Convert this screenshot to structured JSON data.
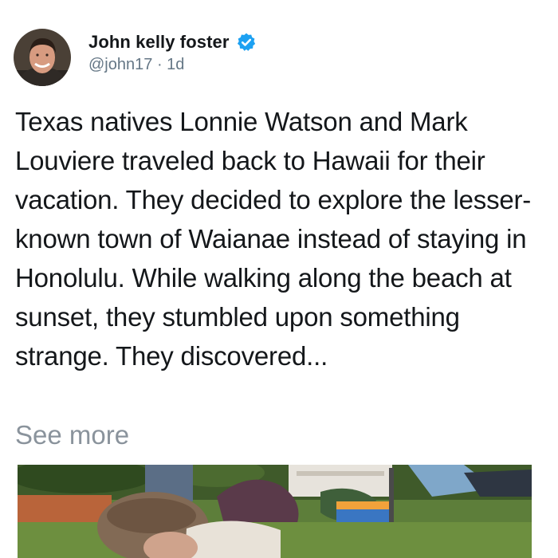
{
  "post": {
    "author": {
      "display_name": "John kelly foster",
      "handle": "@john17",
      "separator": "·",
      "time": "1d",
      "verified": true
    },
    "text": "Texas natives Lonnie Watson and Mark Louviere traveled back to Hawaii for their vacation. They decided to explore the lesser-known town of Waianae instead of staying in Honolulu. While walking along the beach at sunset, they stumbled upon something strange. They discovered...",
    "see_more_label": "See more",
    "media": {
      "type": "photo"
    }
  },
  "colors": {
    "text": "#14171a",
    "secondary_text": "#657786",
    "see_more": "#8a939c",
    "verified": "#1da1f2",
    "background": "#ffffff"
  },
  "icons": {
    "verified": "verified-badge-icon"
  }
}
